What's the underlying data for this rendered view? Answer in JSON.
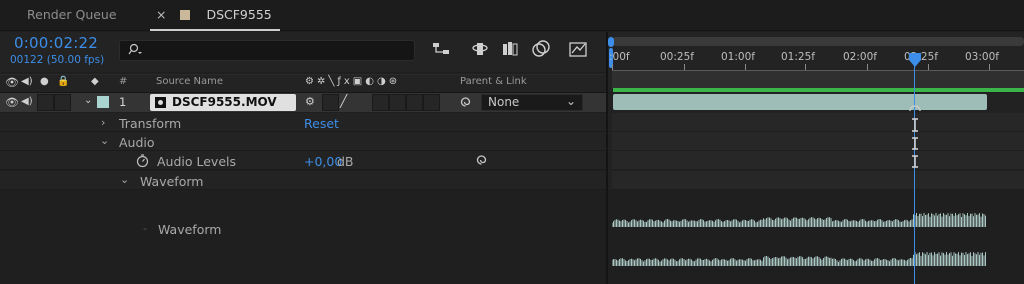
{
  "tabs": {
    "render_queue": "Render Queue",
    "close_glyph": "×",
    "comp_name": "DSCF9555",
    "menu_glyph": "≡"
  },
  "header": {
    "timecode": "0:00:02:22",
    "frame_info": "00122 (50.00 fps)",
    "search_placeholder": ""
  },
  "columns": {
    "number": "#",
    "source_name": "Source Name",
    "parent_link": "Parent & Link"
  },
  "layer": {
    "number": "1",
    "name": "DSCF9555.MOV",
    "parent": "None",
    "label_color": "#a9d4cf"
  },
  "properties": {
    "transform": "Transform",
    "transform_value": "Reset",
    "audio": "Audio",
    "audio_levels": "Audio Levels",
    "audio_levels_value": "+0,00",
    "audio_levels_unit": "dB",
    "waveform_group": "Waveform",
    "waveform": "Waveform"
  },
  "timeline": {
    "ticks": [
      ":00f",
      "00:25f",
      "01:00f",
      "01:25f",
      "02:00f",
      "02:25f",
      "03:00f"
    ],
    "accent": "#3d8ee8"
  }
}
